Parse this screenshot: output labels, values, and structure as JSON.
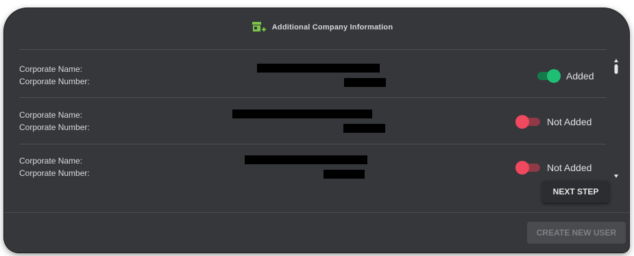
{
  "header": {
    "title": "Additional Company Information",
    "icon": "store-plus-icon",
    "icon_color": "#7cc44a"
  },
  "labels": {
    "corporate_name": "Corporate Name:",
    "corporate_number": "Corporate Number:"
  },
  "companies": [
    {
      "status": "Added",
      "enabled": true
    },
    {
      "status": "Not Added",
      "enabled": false
    },
    {
      "status": "Not Added",
      "enabled": false
    }
  ],
  "colors": {
    "toggle_on": "#1fbf73",
    "toggle_on_track": "#147a4b",
    "toggle_off": "#f0485e",
    "toggle_off_track": "#8f3a46"
  },
  "buttons": {
    "next_step": "NEXT STEP",
    "create_new_user": "CREATE NEW USER",
    "create_new_user_disabled": true
  }
}
